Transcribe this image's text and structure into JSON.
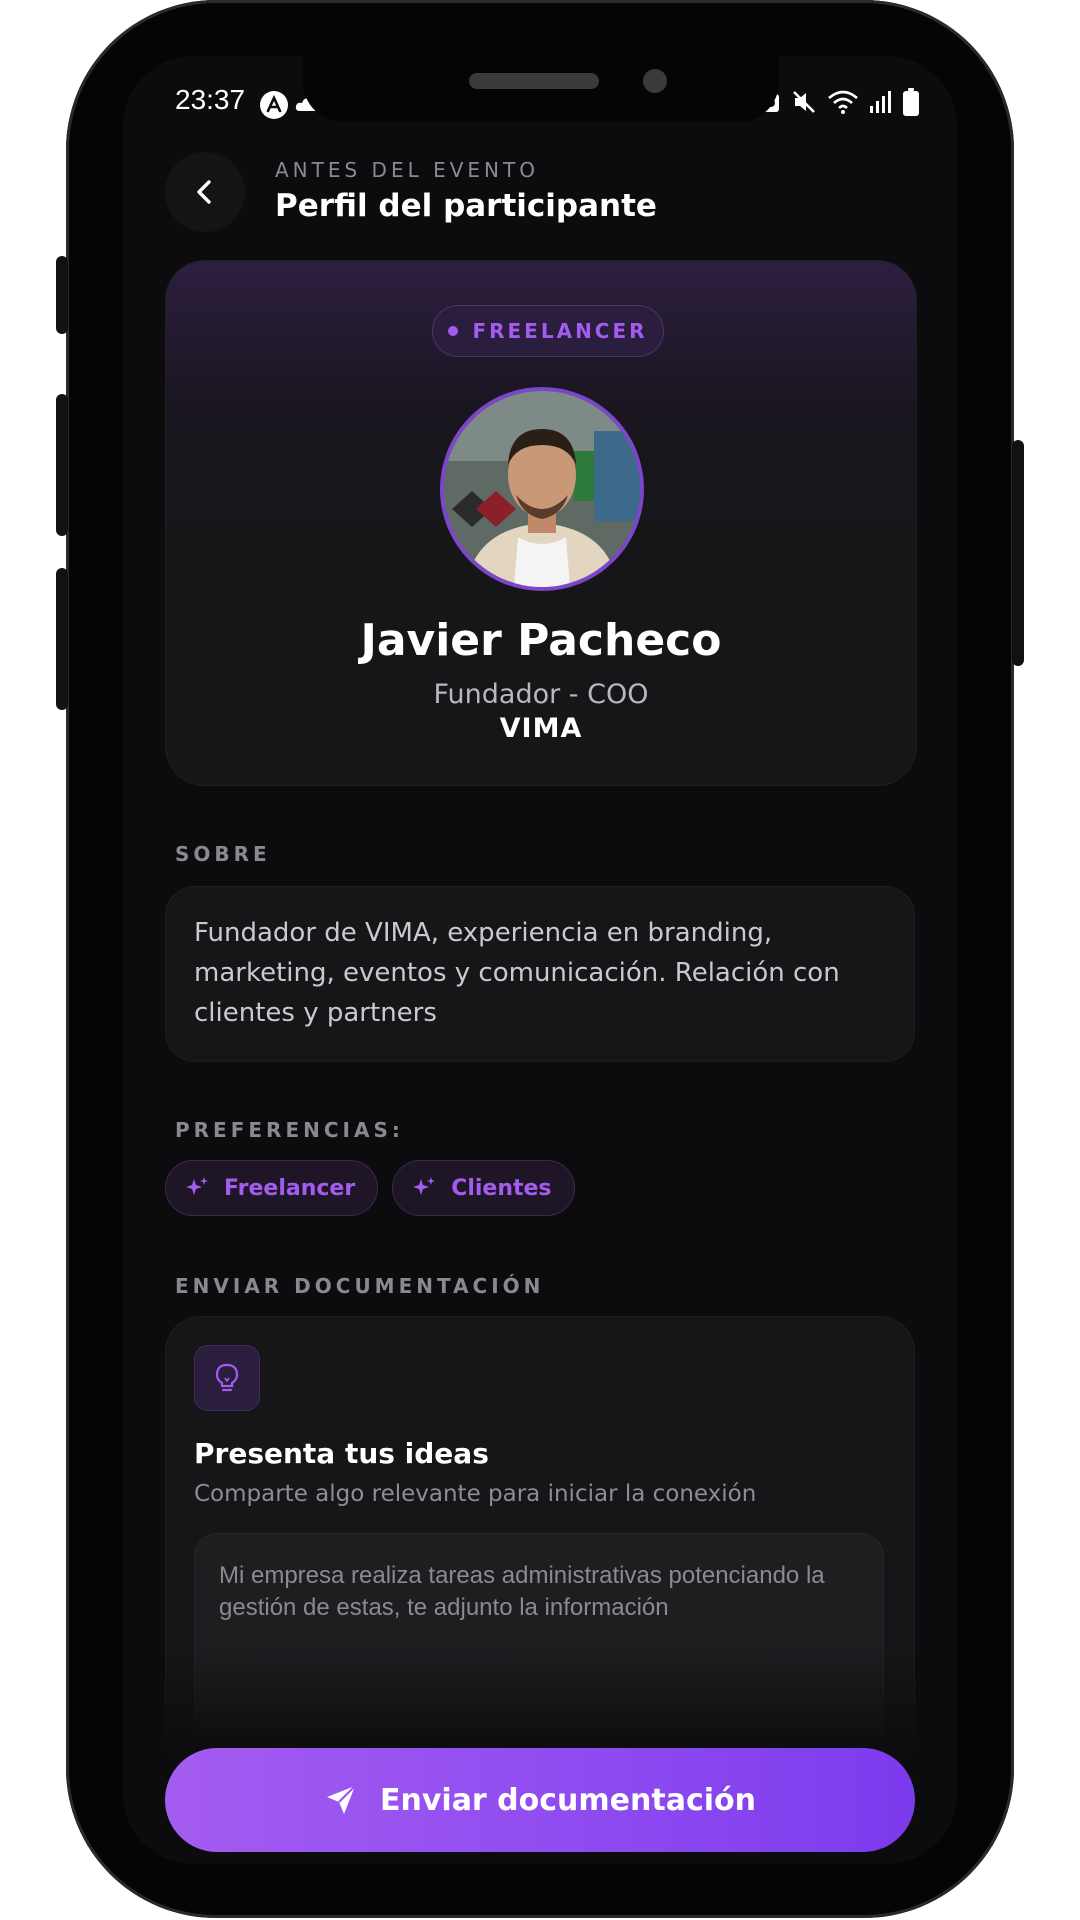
{
  "status_bar": {
    "time": "23:37",
    "left_icons": [
      "app-icon",
      "cloud-icon"
    ],
    "right_icons": [
      "notification-icon",
      "mute-icon",
      "wifi-icon",
      "signal-icon",
      "battery-icon"
    ]
  },
  "header": {
    "eyebrow": "ANTES DEL EVENTO",
    "title": "Perfil del participante",
    "back_icon": "chevron-left-icon"
  },
  "profile": {
    "badge": "FREELANCER",
    "name": "Javier Pacheco",
    "role": "Fundador - COO",
    "company": "VIMA"
  },
  "about": {
    "label": "SOBRE",
    "text": "Fundador de VIMA, experiencia en branding, marketing, eventos y comunicación. Relación con clientes y partners"
  },
  "preferences": {
    "label": "PREFERENCIAS:",
    "items": [
      {
        "label": "Freelancer",
        "icon": "sparkles-icon"
      },
      {
        "label": "Clientes",
        "icon": "sparkles-icon"
      }
    ]
  },
  "documentation": {
    "label": "ENVIAR DOCUMENTACIÓN",
    "icon": "lightbulb-icon",
    "title": "Presenta tus ideas",
    "subtitle": "Comparte algo relevante para iniciar la conexión",
    "input_value": "Mi empresa realiza tareas administrativas potenciando la gestión de estas, te adjunto la información"
  },
  "send_button": {
    "label": "Enviar documentación",
    "icon": "send-icon"
  },
  "colors": {
    "accent": "#a45cf0",
    "accent_dark": "#7c3aed",
    "background": "#0c0c0e",
    "card": "#161618"
  }
}
